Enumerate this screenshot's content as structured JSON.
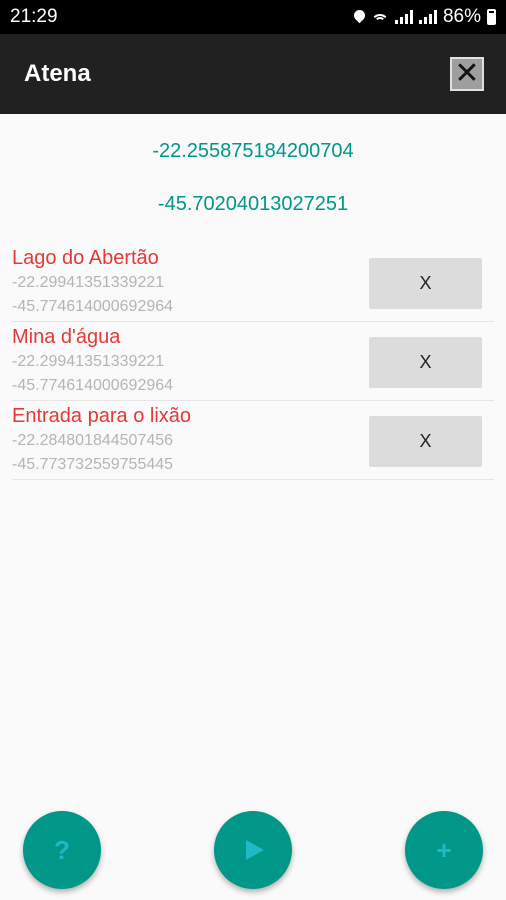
{
  "status_bar": {
    "time": "21:29",
    "battery": "86%",
    "icons": [
      "location-icon",
      "wifi-icon",
      "signal-icon",
      "signal-icon",
      "battery-icon"
    ]
  },
  "app_bar": {
    "title": "Atena",
    "close_label": "✕"
  },
  "current_location": {
    "latitude": "-22.255875184200704",
    "longitude": "-45.70204013027251"
  },
  "places": [
    {
      "name": "Lago do Abertão",
      "latitude": "-22.29941351339221",
      "longitude": "-45.774614000692964",
      "delete_label": "X"
    },
    {
      "name": "Mina d'água",
      "latitude": "-22.29941351339221",
      "longitude": "-45.774614000692964",
      "delete_label": "X"
    },
    {
      "name": "Entrada para o lixão",
      "latitude": "-22.284801844507456",
      "longitude": "-45.773732559755445",
      "delete_label": "X"
    }
  ],
  "fabs": {
    "help_label": "?",
    "add_label": "+"
  },
  "colors": {
    "accent": "#009688",
    "place_name": "#e53935",
    "fab_icon": "#1fb8c8"
  }
}
